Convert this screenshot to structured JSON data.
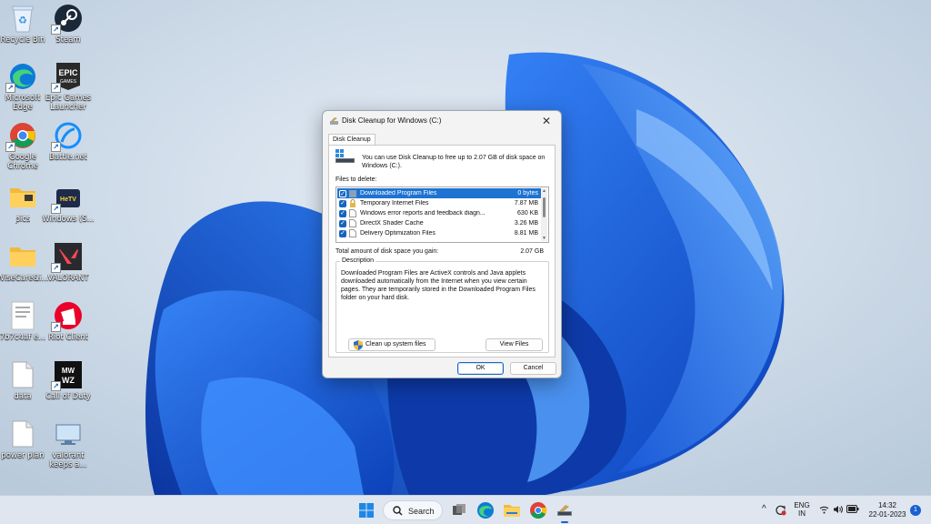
{
  "desktop": {
    "icons": [
      {
        "label": "Recycle Bin",
        "icon": "recycle-bin-icon"
      },
      {
        "label": "Steam",
        "icon": "steam-icon"
      },
      {
        "label": "Microsoft Edge",
        "icon": "edge-icon"
      },
      {
        "label": "Epic Games Launcher",
        "icon": "epic-games-icon"
      },
      {
        "label": "Google Chrome",
        "icon": "chrome-icon"
      },
      {
        "label": "Battle.net",
        "icon": "battlenet-icon"
      },
      {
        "label": "pics",
        "icon": "folder-icon"
      },
      {
        "label": "Windows (S...",
        "icon": "hellotv-app-icon"
      },
      {
        "label": "WiseCare&i...",
        "icon": "folder-icon"
      },
      {
        "label": "VALORANT",
        "icon": "valorant-icon"
      },
      {
        "label": "7b7c4af e...",
        "icon": "document-thumbnail-icon"
      },
      {
        "label": "Riot Client",
        "icon": "riot-client-icon"
      },
      {
        "label": "data",
        "icon": "text-file-icon"
      },
      {
        "label": "Call of Duty",
        "icon": "call-of-duty-icon"
      },
      {
        "label": "power plan",
        "icon": "text-file-icon"
      },
      {
        "label": "valorant keeps a...",
        "icon": "monitor-image-icon"
      }
    ]
  },
  "dialog": {
    "title": "Disk Cleanup for Windows (C:)",
    "close_glyph": "✕",
    "tab_label": "Disk Cleanup",
    "intro": "You can use Disk Cleanup to free up to 2.07 GB of disk space on Windows (C:).",
    "files_label": "Files to delete:",
    "files": [
      {
        "name": "Downloaded Program Files",
        "size": "0 bytes",
        "checked": true,
        "selected": true,
        "icon": "folder-icon"
      },
      {
        "name": "Temporary Internet Files",
        "size": "7.87 MB",
        "checked": true,
        "selected": false,
        "icon": "lock-icon"
      },
      {
        "name": "Windows error reports and feedback diagn...",
        "size": "630 KB",
        "checked": true,
        "selected": false,
        "icon": "file-icon"
      },
      {
        "name": "DirectX Shader Cache",
        "size": "3.26 MB",
        "checked": true,
        "selected": false,
        "icon": "file-icon"
      },
      {
        "name": "Delivery Optimization Files",
        "size": "8.81 MB",
        "checked": true,
        "selected": false,
        "icon": "file-icon"
      }
    ],
    "check_glyph": "✓",
    "total_label": "Total amount of disk space you gain:",
    "total_value": "2.07 GB",
    "description_legend": "Description",
    "description": "Downloaded Program Files are ActiveX controls and Java applets downloaded automatically from the Internet when you view certain pages. They are temporarily stored in the Downloaded Program Files folder on your hard disk.",
    "cleanup_button": "Clean up system files",
    "view_files_button": "View Files",
    "ok_button": "OK",
    "cancel_button": "Cancel"
  },
  "taskbar": {
    "search_label": "Search",
    "language": "ENG",
    "region": "IN",
    "time": "14:32",
    "date": "22-01-2023",
    "notification_count": "1",
    "accent_color": "#1a5fd0"
  }
}
